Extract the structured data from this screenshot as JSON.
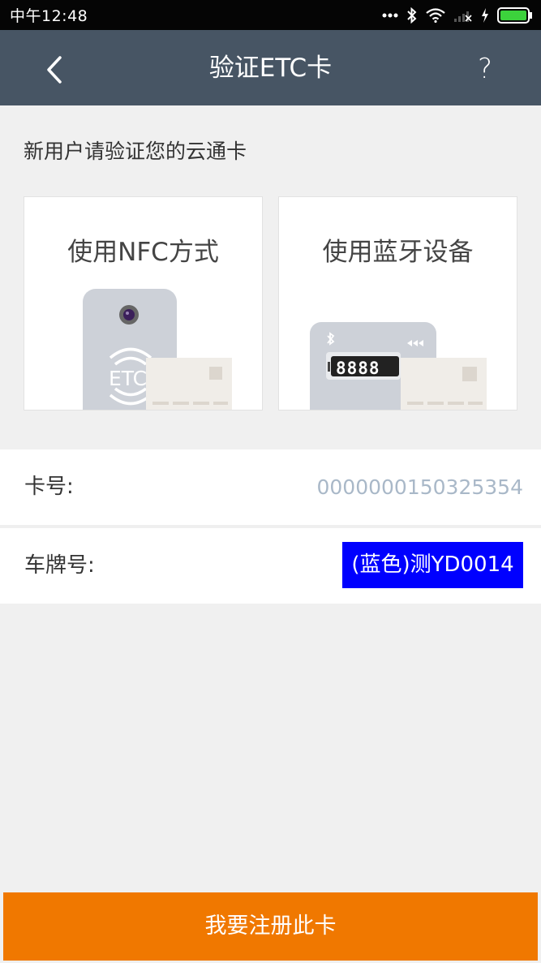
{
  "statusbar": {
    "time": "中午12:48",
    "icons": [
      "more-dots-icon",
      "bluetooth-icon",
      "wifi-icon",
      "signal-off-icon",
      "charging-icon",
      "battery-icon"
    ]
  },
  "header": {
    "title": "验证ETC卡",
    "help_label": "?",
    "back_icon": "chevron-left-icon"
  },
  "main": {
    "subtitle": "新用户请验证您的云通卡",
    "options": [
      {
        "label": "使用NFC方式",
        "device_text": "ETC"
      },
      {
        "label": "使用蓝牙设备",
        "display_text": "8888"
      }
    ]
  },
  "form": {
    "card_number_label": "卡号:",
    "card_number_value": "0000000150325354",
    "plate_label": "车牌号:",
    "plate_value": "(蓝色)测YD0014"
  },
  "footer": {
    "register_label": "我要注册此卡"
  },
  "colors": {
    "header_bg": "#475564",
    "accent": "#f07800",
    "plate_bg": "#0000ff",
    "card_number": "#a9b8c8"
  }
}
